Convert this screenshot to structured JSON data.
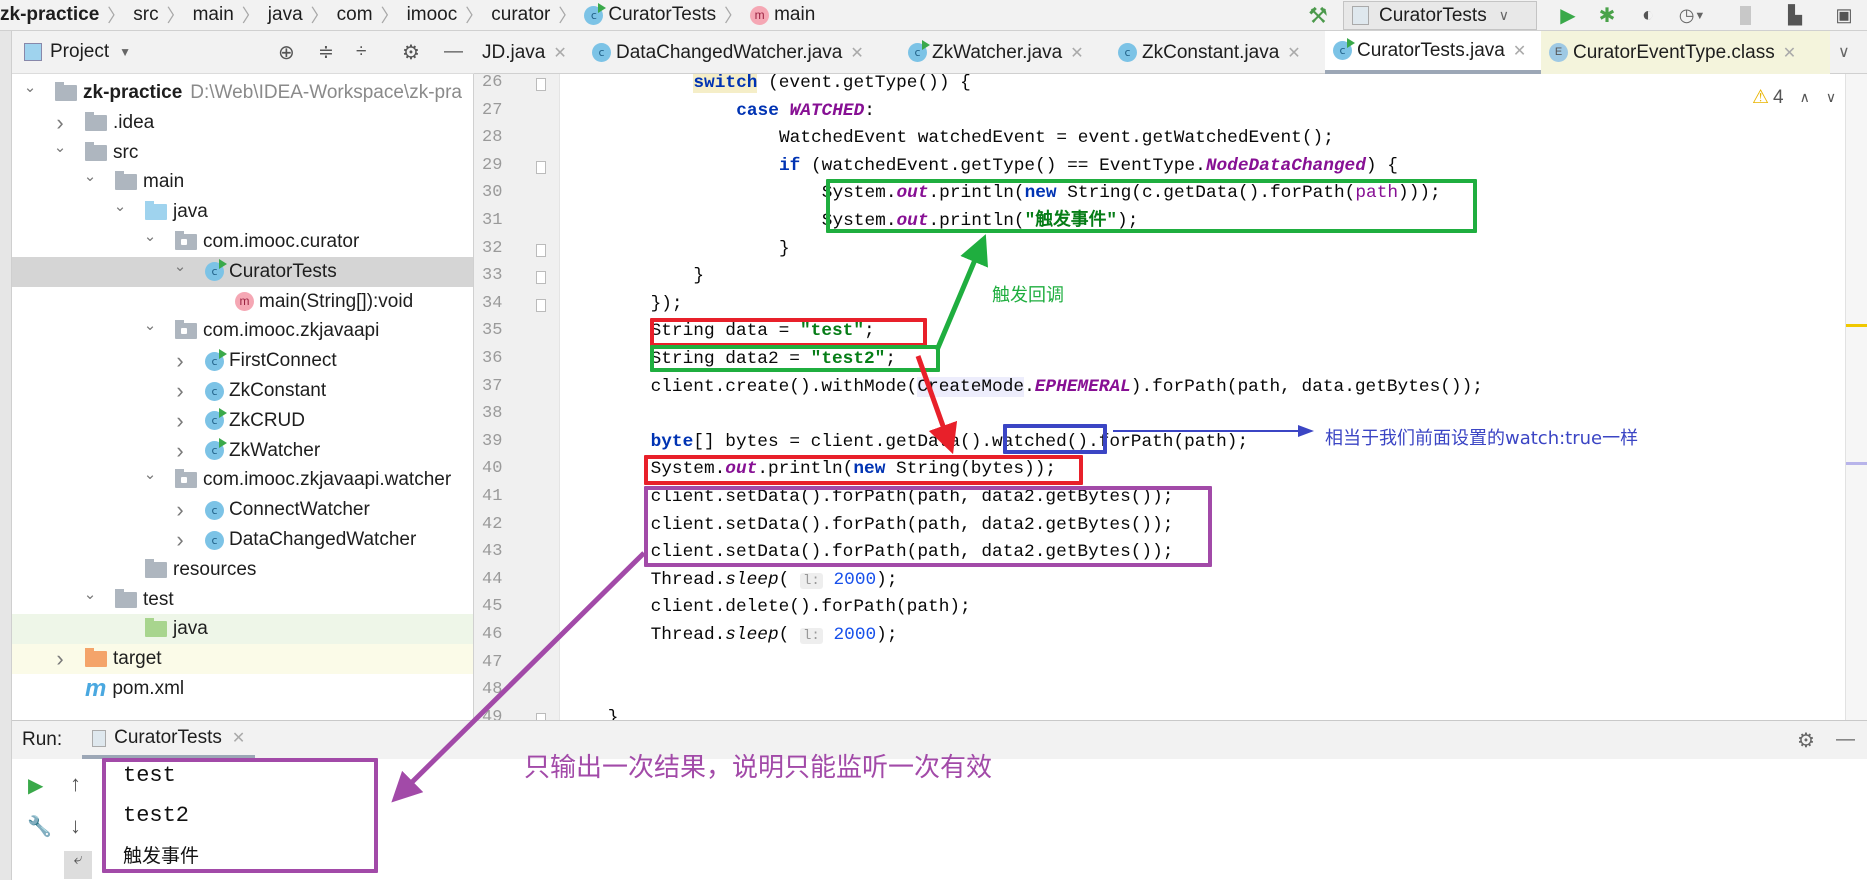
{
  "breadcrumb": [
    "zk-practice",
    "src",
    "main",
    "java",
    "com",
    "imooc",
    "curator",
    "CuratorTests",
    "main"
  ],
  "toolbar": {
    "run_config": "CuratorTests"
  },
  "project_panel": {
    "title": "Project"
  },
  "tabs": [
    {
      "label": "JD.java",
      "icon": "none"
    },
    {
      "label": "DataChangedWatcher.java",
      "icon": "class"
    },
    {
      "label": "ZkWatcher.java",
      "icon": "class-run"
    },
    {
      "label": "ZkConstant.java",
      "icon": "class"
    },
    {
      "label": "CuratorTests.java",
      "icon": "class-run",
      "active": true
    },
    {
      "label": "CuratorEventType.class",
      "icon": "enum"
    }
  ],
  "tree": [
    {
      "label": "zk-practice",
      "path": "D:\\Web\\IDEA-Workspace\\zk-pra",
      "depth": 0,
      "arrow": "open",
      "icon": "module",
      "bold": true
    },
    {
      "label": ".idea",
      "depth": 1,
      "arrow": "closed",
      "icon": "folder"
    },
    {
      "label": "src",
      "depth": 1,
      "arrow": "open",
      "icon": "folder"
    },
    {
      "label": "main",
      "depth": 2,
      "arrow": "open",
      "icon": "folder"
    },
    {
      "label": "java",
      "depth": 3,
      "arrow": "open",
      "icon": "folder-blue"
    },
    {
      "label": "com.imooc.curator",
      "depth": 4,
      "arrow": "open",
      "icon": "package"
    },
    {
      "label": "CuratorTests",
      "depth": 5,
      "arrow": "open",
      "icon": "class-run",
      "selected": true
    },
    {
      "label": "main(String[]):void",
      "depth": 6,
      "arrow": "none",
      "icon": "method"
    },
    {
      "label": "com.imooc.zkjavaapi",
      "depth": 4,
      "arrow": "open",
      "icon": "package"
    },
    {
      "label": "FirstConnect",
      "depth": 5,
      "arrow": "closed",
      "icon": "class-run"
    },
    {
      "label": "ZkConstant",
      "depth": 5,
      "arrow": "closed",
      "icon": "class"
    },
    {
      "label": "ZkCRUD",
      "depth": 5,
      "arrow": "closed",
      "icon": "class-run"
    },
    {
      "label": "ZkWatcher",
      "depth": 5,
      "arrow": "closed",
      "icon": "class-run"
    },
    {
      "label": "com.imooc.zkjavaapi.watcher",
      "depth": 4,
      "arrow": "open",
      "icon": "package"
    },
    {
      "label": "ConnectWatcher",
      "depth": 5,
      "arrow": "closed",
      "icon": "class"
    },
    {
      "label": "DataChangedWatcher",
      "depth": 5,
      "arrow": "closed",
      "icon": "class"
    },
    {
      "label": "resources",
      "depth": 3,
      "arrow": "none",
      "icon": "folder-res"
    },
    {
      "label": "test",
      "depth": 2,
      "arrow": "open",
      "icon": "folder"
    },
    {
      "label": "java",
      "depth": 3,
      "arrow": "none",
      "icon": "folder-green",
      "tint": "green"
    },
    {
      "label": "target",
      "depth": 1,
      "arrow": "closed",
      "icon": "folder-orange",
      "tint": "yellow"
    },
    {
      "label": "pom.xml",
      "depth": 1,
      "arrow": "none",
      "icon": "maven"
    }
  ],
  "editor": {
    "warnings": "4",
    "current_line": 37,
    "lines": [
      {
        "n": 26,
        "indent": 12,
        "t": [
          [
            "switch",
            "kw sw"
          ],
          [
            " (event.getType()) {",
            ""
          ]
        ]
      },
      {
        "n": 27,
        "indent": 16,
        "t": [
          [
            "case ",
            "kw"
          ],
          [
            "WATCHED",
            "fld"
          ],
          [
            ":",
            ""
          ]
        ]
      },
      {
        "n": 28,
        "indent": 20,
        "t": [
          [
            "WatchedEvent watchedEvent = event.getWatchedEvent();",
            ""
          ]
        ]
      },
      {
        "n": 29,
        "indent": 20,
        "t": [
          [
            "if",
            "kw"
          ],
          [
            " (watchedEvent.getType() == EventType.",
            ""
          ],
          [
            "NodeDataChanged",
            "fld"
          ],
          [
            ") {",
            ""
          ]
        ]
      },
      {
        "n": 30,
        "indent": 24,
        "t": [
          [
            "System.",
            ""
          ],
          [
            "out",
            "fld"
          ],
          [
            ".println(",
            ""
          ],
          [
            "new",
            "kw"
          ],
          [
            " String(c.getData().forPath(",
            ""
          ],
          [
            "path",
            "fld2"
          ],
          [
            ")));",
            ""
          ]
        ]
      },
      {
        "n": 31,
        "indent": 24,
        "t": [
          [
            "System.",
            ""
          ],
          [
            "out",
            "fld"
          ],
          [
            ".println(",
            ""
          ],
          [
            "\"触发事件\"",
            "str"
          ],
          [
            ");",
            ""
          ]
        ]
      },
      {
        "n": 32,
        "indent": 20,
        "t": [
          [
            "}",
            ""
          ]
        ]
      },
      {
        "n": 33,
        "indent": 12,
        "t": [
          [
            "}",
            ""
          ]
        ]
      },
      {
        "n": 34,
        "indent": 8,
        "t": [
          [
            "});",
            ""
          ]
        ]
      },
      {
        "n": 35,
        "indent": 8,
        "t": [
          [
            "String data = ",
            ""
          ],
          [
            "\"test\"",
            "str"
          ],
          [
            ";",
            ""
          ]
        ]
      },
      {
        "n": 36,
        "indent": 8,
        "t": [
          [
            "String data2 = ",
            ""
          ],
          [
            "\"test2\"",
            "str"
          ],
          [
            ";",
            ""
          ]
        ]
      },
      {
        "n": 37,
        "indent": 8,
        "t": [
          [
            "client.create().withMode(",
            ""
          ],
          [
            "CreateMode",
            "hl"
          ],
          [
            ".",
            ""
          ],
          [
            "EPHEMERAL",
            "fld"
          ],
          [
            ").forPath(path, data.getBytes());",
            ""
          ]
        ]
      },
      {
        "n": 38,
        "indent": 0,
        "t": []
      },
      {
        "n": 39,
        "indent": 8,
        "t": [
          [
            "byte",
            "kw"
          ],
          [
            "[] bytes = client.getData().watched().forPath(path);",
            ""
          ]
        ]
      },
      {
        "n": 40,
        "indent": 8,
        "t": [
          [
            "System.",
            ""
          ],
          [
            "out",
            "fld"
          ],
          [
            ".println(",
            ""
          ],
          [
            "new",
            "kw"
          ],
          [
            " String(bytes));",
            ""
          ]
        ]
      },
      {
        "n": 41,
        "indent": 8,
        "t": [
          [
            "client.setData().forPath(path, data2.getBytes());",
            ""
          ]
        ]
      },
      {
        "n": 42,
        "indent": 8,
        "t": [
          [
            "client.setData().forPath(path, data2.getBytes());",
            ""
          ]
        ]
      },
      {
        "n": 43,
        "indent": 8,
        "t": [
          [
            "client.setData().forPath(path, data2.getBytes());",
            ""
          ]
        ]
      },
      {
        "n": 44,
        "indent": 8,
        "t": [
          [
            "Thread.",
            ""
          ],
          [
            "sleep",
            "it"
          ],
          [
            "( ",
            ""
          ],
          [
            "l:",
            "hint"
          ],
          [
            " ",
            ""
          ],
          [
            "2000",
            "num"
          ],
          [
            ");",
            ""
          ]
        ]
      },
      {
        "n": 45,
        "indent": 8,
        "t": [
          [
            "client.delete().forPath(path);",
            ""
          ]
        ]
      },
      {
        "n": 46,
        "indent": 8,
        "t": [
          [
            "Thread.",
            ""
          ],
          [
            "sleep",
            "it"
          ],
          [
            "( ",
            ""
          ],
          [
            "l:",
            "hint"
          ],
          [
            " ",
            ""
          ],
          [
            "2000",
            "num"
          ],
          [
            ");",
            ""
          ]
        ]
      },
      {
        "n": 47,
        "indent": 0,
        "t": []
      },
      {
        "n": 48,
        "indent": 0,
        "t": []
      },
      {
        "n": 49,
        "indent": 4,
        "t": [
          [
            "}",
            ""
          ]
        ]
      }
    ]
  },
  "run": {
    "label": "Run:",
    "tab": "CuratorTests",
    "output": [
      "test",
      "test2",
      "触发事件"
    ]
  },
  "annotations": {
    "callback": "触发回调",
    "watched_note": "相当于我们前面设置的watch:true一样",
    "conclusion": "只输出一次结果，说明只能监听一次有效"
  },
  "colors": {
    "green": "#1fae3f",
    "red": "#e8202a",
    "blue": "#3b45c4",
    "purple": "#a24aa8"
  }
}
